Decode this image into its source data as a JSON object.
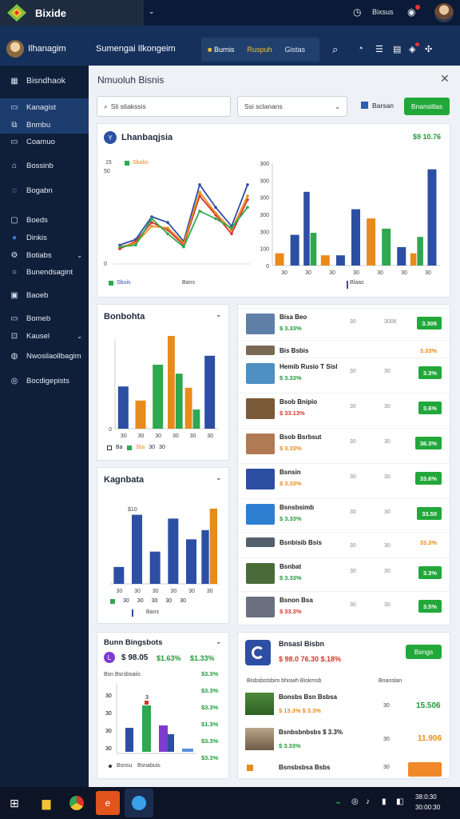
{
  "top": {
    "brand": "Bixide",
    "dropdown_caret": "⌄",
    "status_text": "Bixsus",
    "icon_color": "#e6e9f0"
  },
  "header": {
    "workspace": "Ilhanagim",
    "page_title": "Sumengai Ilkongeim",
    "tabs": [
      "Burnis",
      "Ruspuh",
      "Gistas"
    ]
  },
  "sidebar": {
    "items": [
      {
        "label": "Bisndhaok",
        "icon": "dashboard-icon"
      },
      {
        "label": "Kanagist",
        "icon": "monitor-icon"
      },
      {
        "label": "Bnmbu",
        "icon": "chart-icon"
      },
      {
        "label": "Coamuo",
        "icon": "tag-icon"
      },
      {
        "label": "Bossinb",
        "icon": "home-icon"
      },
      {
        "label": "Bogabn",
        "icon": "chat-icon"
      },
      {
        "label": "Boeds",
        "icon": "box-icon"
      },
      {
        "label": "Dinkis",
        "icon": "globe-icon"
      },
      {
        "label": "Botiabs",
        "icon": "sliders-icon"
      },
      {
        "label": "Bunendsagint",
        "icon": "circle-icon"
      },
      {
        "label": "Baoeb",
        "icon": "grid-icon"
      },
      {
        "label": "Bomeb",
        "icon": "inbox-icon"
      },
      {
        "label": "Kausel",
        "icon": "settings-icon"
      },
      {
        "label": "Nwosilaollbagim",
        "icon": "user-icon"
      },
      {
        "label": "Bocdigepists",
        "icon": "help-icon"
      }
    ]
  },
  "modal": {
    "title": "Nmuoluh Bisnis",
    "search_placeholder": "Sli stiakssis",
    "select_value": "Ssi sclanans",
    "legend_label": "Barsan",
    "action_label": "Bnansitlas"
  },
  "overview_card": {
    "title": "Lhanbaqjsia",
    "value": "$9 10.76",
    "legend_left": [
      {
        "label": "15",
        "color": "#333"
      },
      {
        "label": "Sbabs",
        "color": "#e98a1c"
      }
    ],
    "footer_left": "Sbuis",
    "footer_mid": "Bans",
    "footer_right": "Blaas"
  },
  "chart_data": [
    {
      "type": "line",
      "y_ticks": [
        "0",
        "50"
      ],
      "ylim": [
        0,
        50
      ],
      "series": [
        {
          "color": "#2c4fa3",
          "values": [
            10,
            13,
            25,
            22,
            12,
            42,
            30,
            20,
            42
          ]
        },
        {
          "color": "#d9342b",
          "values": [
            8,
            12,
            22,
            18,
            10,
            36,
            26,
            16,
            34
          ]
        },
        {
          "color": "#e98a1c",
          "values": [
            9,
            11,
            20,
            19,
            11,
            38,
            27,
            18,
            36
          ]
        },
        {
          "color": "#2fa84f",
          "values": [
            9,
            10,
            24,
            16,
            9,
            28,
            24,
            19,
            30
          ]
        }
      ]
    },
    {
      "type": "bar",
      "y_ticks": [
        "0",
        "100",
        "300",
        "300",
        "300",
        "300",
        "300"
      ],
      "x_ticks": [
        "30",
        "30",
        "30",
        "30",
        "30",
        "30",
        "30"
      ],
      "ylim": [
        0,
        100
      ],
      "series": [
        {
          "color": "#2c4fa3",
          "values": [
            0,
            30,
            72,
            0,
            10,
            55,
            0,
            0,
            18,
            0,
            94
          ]
        },
        {
          "color": "#e98a1c",
          "values": [
            12,
            0,
            0,
            10,
            0,
            0,
            46,
            0,
            0,
            12,
            0
          ]
        },
        {
          "color": "#2fa84f",
          "values": [
            0,
            0,
            32,
            0,
            0,
            0,
            0,
            36,
            0,
            28,
            0
          ]
        }
      ]
    },
    {
      "type": "bar",
      "title": "Bonbohta",
      "x_ticks": [
        "30",
        "30",
        "30",
        "30",
        "30",
        "30"
      ],
      "y_ticks": [
        "0"
      ],
      "ylim": [
        0,
        70
      ],
      "series": [
        {
          "color": "#2c4fa3",
          "values": [
            33,
            0,
            0,
            0,
            0,
            57
          ]
        },
        {
          "color": "#e98a1c",
          "values": [
            0,
            22,
            0,
            90,
            32,
            0
          ]
        },
        {
          "color": "#2fa84f",
          "values": [
            0,
            0,
            50,
            43,
            15,
            0
          ]
        }
      ],
      "legend": [
        "Ba",
        "3ba",
        "30",
        "30"
      ]
    },
    {
      "type": "bar",
      "title": "Kagnbata",
      "x_ticks": [
        "30",
        "30",
        "30",
        "30",
        "30",
        "30"
      ],
      "ylim": [
        0,
        100
      ],
      "top_label": "$10",
      "series": [
        {
          "color": "#2c4fa3",
          "values": [
            22,
            90,
            42,
            85,
            58,
            70
          ]
        },
        {
          "color": "#e98a1c",
          "values": [
            0,
            0,
            0,
            0,
            0,
            98
          ]
        }
      ],
      "legend": [
        "30",
        "30",
        "30",
        "30",
        "30",
        "30"
      ],
      "footer": "Bans"
    }
  ],
  "list_items": [
    {
      "title": "Bisa Beo",
      "sub": "$ 3.33%",
      "sub_color": "green",
      "meta": "30",
      "meta2": "3006",
      "pill": "3.306",
      "pill_color": "green"
    },
    {
      "title": "Bis Bsbis",
      "sub": "",
      "sub_color": "green",
      "meta": "",
      "meta2": "",
      "pill": "3.33%",
      "pill_color": "orange"
    },
    {
      "title": "Hemib Rusio T Sisl",
      "sub": "$ 3.33%",
      "sub_color": "green",
      "meta": "30",
      "meta2": "30",
      "pill": "3.3%",
      "pill_color": "green"
    },
    {
      "title": "Bsob Bnipio",
      "sub": "$ 33.13%",
      "sub_color": "red",
      "meta": "30",
      "meta2": "30",
      "pill": "3.6%",
      "pill_color": "green"
    },
    {
      "title": "Bsob Bsrbsut",
      "sub": "$ 3.33%",
      "sub_color": "orange",
      "meta": "30",
      "meta2": "30",
      "pill": "36.3%",
      "pill_color": "green"
    },
    {
      "title": "Bsnsin",
      "sub": "$ 3.33%",
      "sub_color": "orange",
      "meta": "30",
      "meta2": "30",
      "pill": "33.6%",
      "pill_color": "green"
    },
    {
      "title": "Bsnsbsimb",
      "sub": "$ 3.33%",
      "sub_color": "green",
      "meta": "30",
      "meta2": "30",
      "pill": "33.50",
      "pill_color": "green"
    },
    {
      "title": "Bsnbisib Bsis",
      "sub": "",
      "sub_color": "green",
      "meta": "30",
      "meta2": "30",
      "pill": "33.3%",
      "pill_color": "orange"
    },
    {
      "title": "Bsnbat",
      "sub": "$ 3.33%",
      "sub_color": "green",
      "meta": "30",
      "meta2": "30",
      "pill": "3.3%",
      "pill_color": "green"
    },
    {
      "title": "Bsnon Bsa",
      "sub": "$ 33.3%",
      "sub_color": "red",
      "meta": "30",
      "meta2": "30",
      "pill": "3.5%",
      "pill_color": "green"
    }
  ],
  "bottom_left": {
    "title": "Bunn Bingsbots",
    "stat1": "$ 98.05",
    "stat2": "$1.63%",
    "stat3": "$1.33%",
    "sub": "Bsn Bsrsbsaiis",
    "col_right": [
      "$3.3%",
      "$3.3%",
      "$3.3%",
      "$1.3%",
      "$3.3%",
      "$3.3%"
    ],
    "footer": [
      "Bsnsu",
      "Bsnabuis"
    ],
    "chart_top": "3"
  },
  "bottom_right": {
    "title": "Bnsasl Bisbn",
    "sub": "$ 98.0 76.30 $.18%",
    "action": "Bsngs",
    "col_header": "Bisbsbstsbim bhiswh Biskmsb",
    "col_header_right": "Bnanslan",
    "rows": [
      {
        "title": "Bonsbs Bsn Bsbsa",
        "sub": "$ 13.3% $ 3.3%",
        "meta": "30",
        "value": "15.506",
        "value_color": "green"
      },
      {
        "title": "Bsnbsbnbsbs $ 3.3%",
        "sub": "$ 3.33%",
        "meta": "30",
        "value": "11.906",
        "value_color": "orange"
      }
    ],
    "footer_label": "Bsnsbsbsa Bsbs",
    "footer_meta": "30"
  },
  "taskbar": {
    "time": "38:0:30",
    "date": "30:00:30"
  }
}
